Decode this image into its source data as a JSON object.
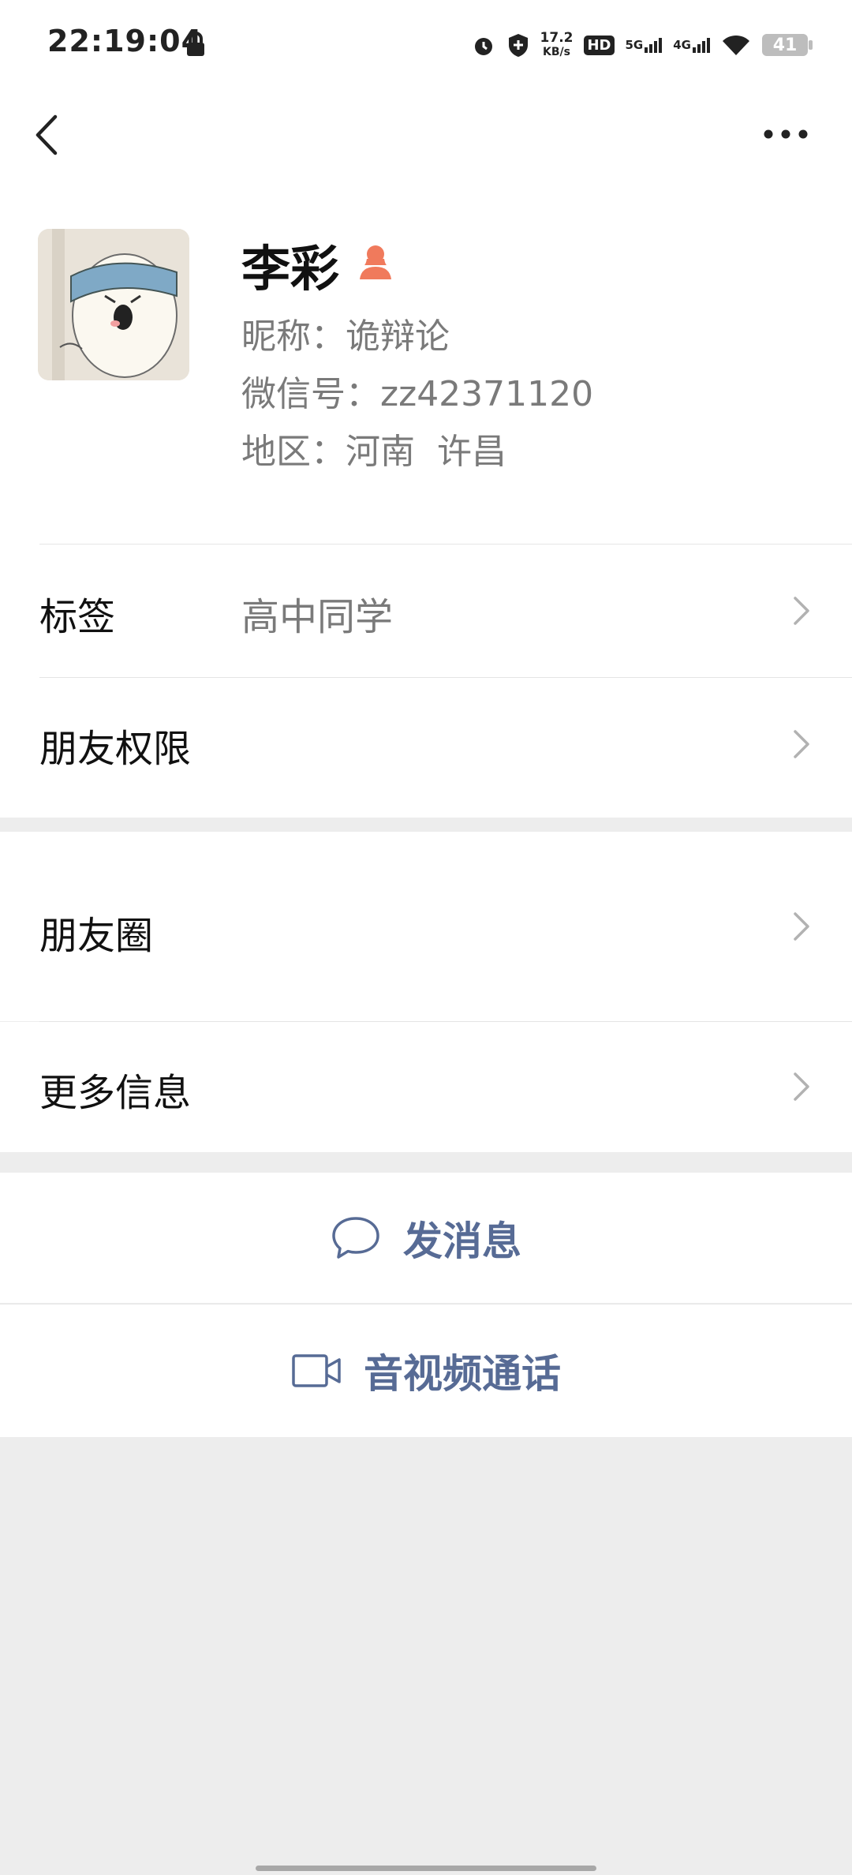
{
  "status_bar": {
    "time": "22:19:04",
    "net_speed_value": "17.2",
    "net_speed_unit": "KB/s",
    "hd_label": "HD",
    "sig1_label": "5G",
    "sig2_label": "4G",
    "battery": "41"
  },
  "profile": {
    "name": "李彩",
    "nickname": "昵称：诡辩论",
    "wechat_id": "微信号：zz42371120",
    "region": "地区：河南  许昌"
  },
  "rows": {
    "tags_label": "标签",
    "tags_value": "高中同学",
    "permissions_label": "朋友权限",
    "moments_label": "朋友圈",
    "more_info_label": "更多信息"
  },
  "actions": {
    "send_message": "发消息",
    "video_call": "音视频通话"
  },
  "colors": {
    "link_blue": "#576b95",
    "gender_female": "#f07a5c",
    "background": "#ededed"
  }
}
